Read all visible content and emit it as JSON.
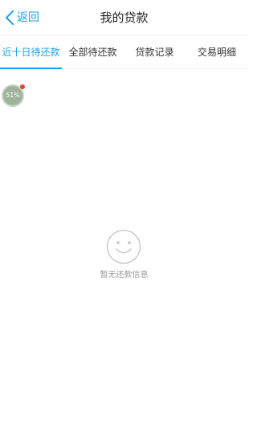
{
  "header": {
    "back_label": "返回",
    "title": "我的贷款"
  },
  "tabs": [
    {
      "label": "近十日待还款",
      "active": true
    },
    {
      "label": "全部待还款",
      "active": false
    },
    {
      "label": "贷款记录",
      "active": false
    },
    {
      "label": "交易明细",
      "active": false
    }
  ],
  "float_ball": {
    "text": "51%",
    "notification_dot": true
  },
  "empty_state": {
    "icon": "smiley-face-icon",
    "message": "暂无还款信息"
  },
  "colors": {
    "accent": "#1aa3e0",
    "text_primary": "#222222",
    "text_muted": "#999999",
    "badge_red": "#ff3b30",
    "ball_green": "#9fb39a"
  }
}
